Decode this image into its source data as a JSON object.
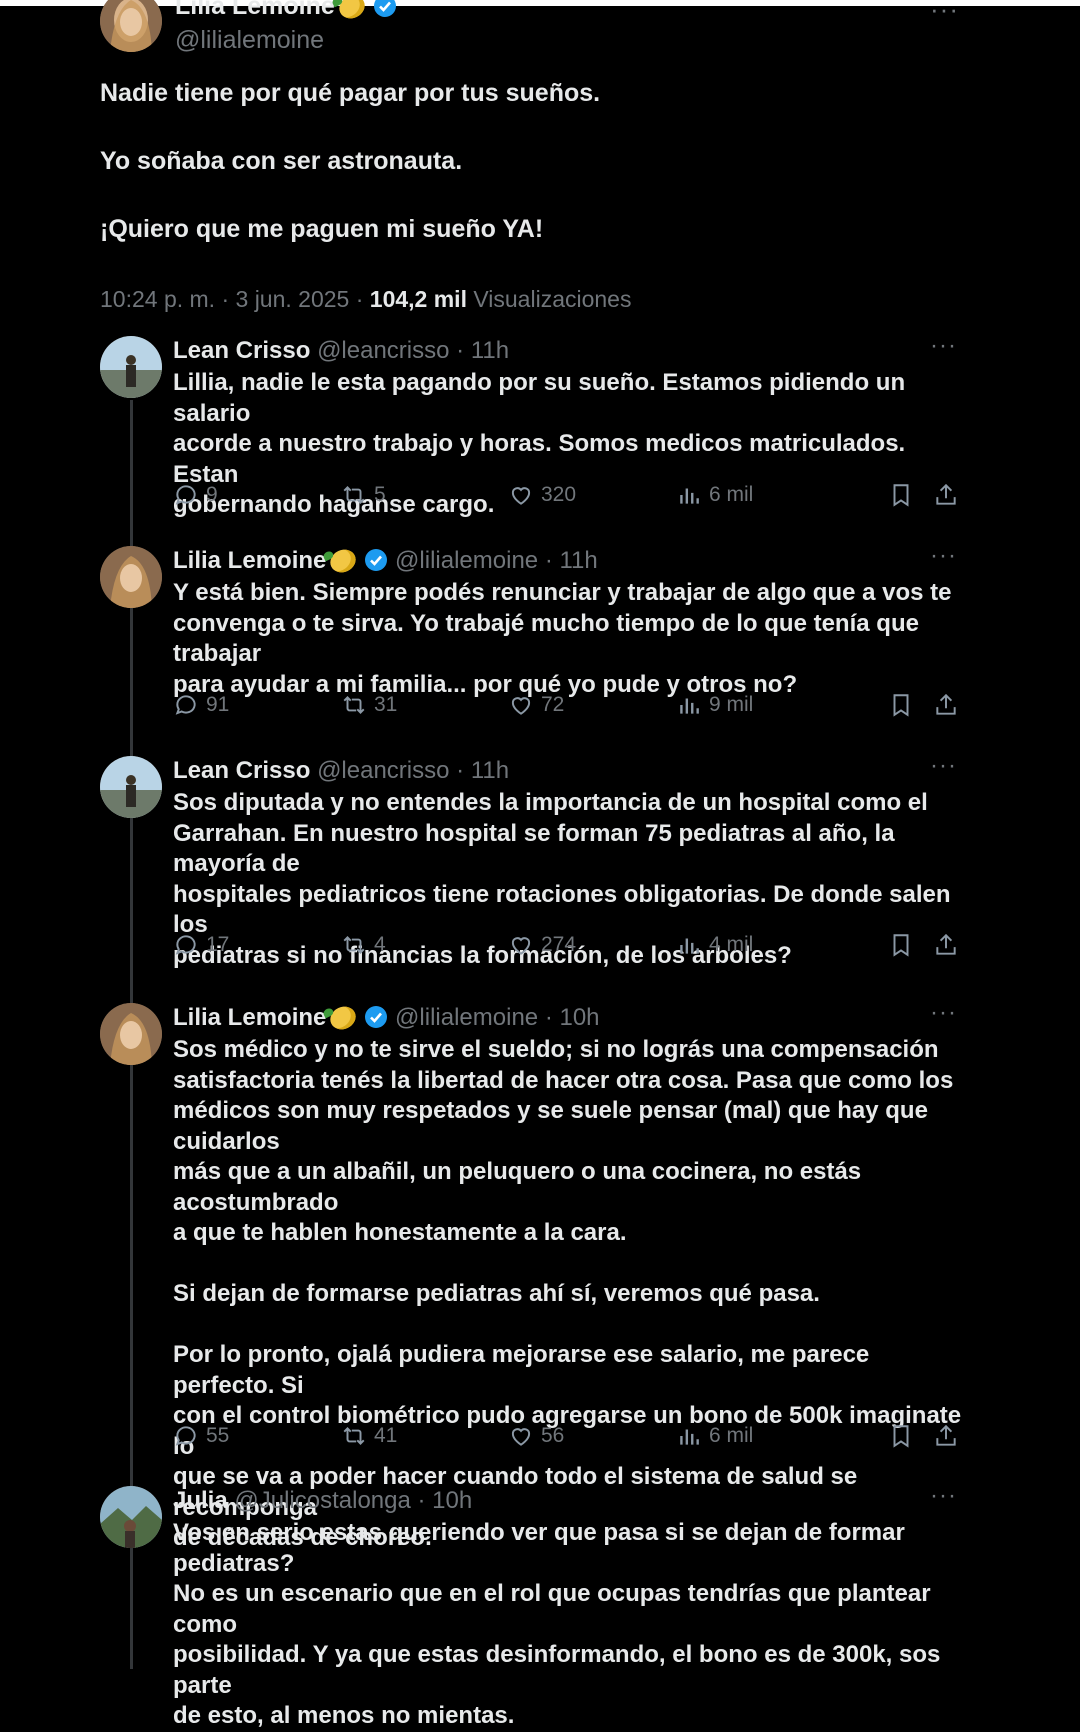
{
  "main": {
    "author": "Lilia Lemoine",
    "handle": "@lilialemoine",
    "paragraphs": [
      "Nadie tiene por qué pagar por tus sueños.",
      "Yo soñaba con ser astronauta.",
      "¡Quiero que me paguen mi sueño YA!"
    ],
    "time": "10:24 p. m. · 3 jun. 2025 ·",
    "views_count": "104,2 mil",
    "views_label": "Visualizaciones",
    "more": "···"
  },
  "replies": [
    {
      "name": "Lean Crisso",
      "handle": "@leancrisso",
      "time": "· 11h",
      "verified": false,
      "text": "Lillia, nadie le esta pagando por su sueño. Estamos pidiendo un salario\nacorde a nuestro trabajo y horas. Somos medicos matriculados. Estan\ngobernando haganse cargo.",
      "comments": "9",
      "reposts": "5",
      "likes": "320",
      "views": "6 mil"
    },
    {
      "name": "Lilia Lemoine",
      "handle": "@lilialemoine",
      "time": "· 11h",
      "verified": true,
      "text": "Y está bien. Siempre podés renunciar y trabajar de algo que a vos te\nconvenga o te sirva. Yo trabajé mucho tiempo de lo que tenía que trabajar\npara ayudar a mi familia... por qué yo pude y otros no?",
      "comments": "91",
      "reposts": "31",
      "likes": "72",
      "views": "9 mil"
    },
    {
      "name": "Lean Crisso",
      "handle": "@leancrisso",
      "time": "· 11h",
      "verified": false,
      "text": "Sos diputada y no entendes la importancia de un hospital como el\nGarrahan. En nuestro hospital se forman 75 pediatras al año, la mayoría de\nhospitales pediatricos tiene rotaciones obligatorias. De donde salen los\npediatras si no financias la formación, de los arboles?",
      "comments": "17",
      "reposts": "4",
      "likes": "274",
      "views": "4 mil"
    },
    {
      "name": "Lilia Lemoine",
      "handle": "@lilialemoine",
      "time": "· 10h",
      "verified": true,
      "text": "Sos médico y no te sirve el sueldo; si no lográs una compensación\nsatisfactoria tenés la libertad de hacer otra cosa. Pasa que como los\nmédicos son muy respetados y se suele pensar (mal) que hay que cuidarlos\nmás que a un albañil, un peluquero o una cocinera, no estás acostumbrado\na que te hablen honestamente a la cara.\n\nSi dejan de formarse pediatras ahí sí, veremos qué pasa.\n\nPor lo pronto, ojalá pudiera mejorarse ese salario, me parece perfecto. Si\ncon el control biométrico pudo agregarse un bono de 500k imaginate lo\nque se va a poder hacer cuando todo el sistema de salud se recomponga\nde décadas de choreo.",
      "comments": "55",
      "reposts": "41",
      "likes": "56",
      "views": "6 mil"
    },
    {
      "name": "Julia",
      "handle": "@Julicostalonga",
      "time": "· 10h",
      "verified": false,
      "text": "Vos en serio estas queriendo ver que pasa si se dejan de formar pediatras?\nNo es un escenario que en el rol que ocupas tendrías que plantear como\nposibilidad. Y ya que estas desinformando, el bono es de 300k, sos parte\nde esto, al menos no mientas."
    }
  ],
  "icons": {
    "comment": "comment-icon",
    "repost": "repost-icon",
    "like": "heart-icon",
    "views": "views-bar-icon",
    "bookmark": "bookmark-icon",
    "share": "share-icon"
  },
  "colors": {
    "background": "#000000",
    "text": "#e7e9ea",
    "muted": "#71767b",
    "verified": "#1d9bf0"
  }
}
